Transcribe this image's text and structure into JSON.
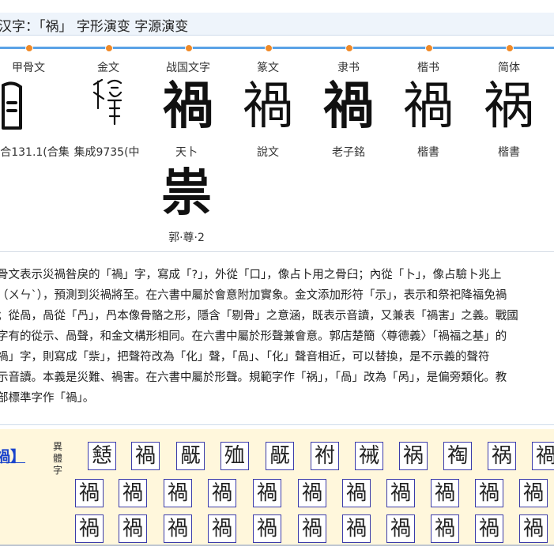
{
  "title": "汉字：「祸」 字形演变 字源演变",
  "eras": [
    "甲骨文",
    "金文",
    "战国文字",
    "篆文",
    "隶书",
    "楷书",
    "简体"
  ],
  "glyphs": [
    "𠮷",
    "禍",
    "禍",
    "禍",
    "禍",
    "禍",
    "祸",
    "祟"
  ],
  "sources": [
    "合131.1(合集",
    "集成9735(中",
    "天卜",
    "說文",
    "老子銘",
    "楷書",
    "楷書",
    "郭·尊·2"
  ],
  "description": [
    "骨文表示災禍咎戾的「禍」字，寫成「?」，外從「口」，像占卜用之骨臼；內從「卜」，像占驗卜兆上",
    "（ㄨㄣˋ），預測到災禍將至。在六書中屬於會意附加實象。金文添加形符「示」，表示和祭祀降福免禍",
    "；從咼，咼從「冎」，冎本像骨骼之形，隱含「剔骨」之意涵，既表示音讀，又兼表「禍害」之義。戰國",
    "字有的從示、咼聲，和金文構形相同。在六書中屬於形聲兼會意。郭店楚簡〈尊德義〉「禍福之基」的",
    "禍」字，則寫成「祡」，把聲符改為「化」聲，「咼」、「化」聲音相近，可以替換，是不示義的聲符",
    "示音讀。本義是災難、禍害。在六書中屬於形聲。規範字作「祸」，「咼」改為「呙」，是偏旁類化。教",
    "部標準字作「禍」。"
  ],
  "variants": {
    "link_label": "禍】",
    "side_label": [
      "異",
      "體",
      "字"
    ],
    "rows": [
      [
        "懖",
        "禍",
        "旤",
        "殈",
        "旤",
        "祔",
        "祴",
        "祸",
        "祹",
        "祸",
        "禍"
      ],
      [
        "禍",
        "禍",
        "禍",
        "禍",
        "禍",
        "禍",
        "禍",
        "禍",
        "禍",
        "禍",
        "禍"
      ],
      [
        "禍",
        "禍",
        "禍",
        "禍",
        "禍",
        "禍",
        "禍",
        "禍",
        "禍",
        "禍",
        "禍"
      ]
    ]
  },
  "colors": {
    "accent": "#5aa2e6",
    "timeline_dot": "#f08a28",
    "link": "#1a44cc",
    "variants_bg": "#fff7dc",
    "cell_border": "#3c3caa"
  }
}
